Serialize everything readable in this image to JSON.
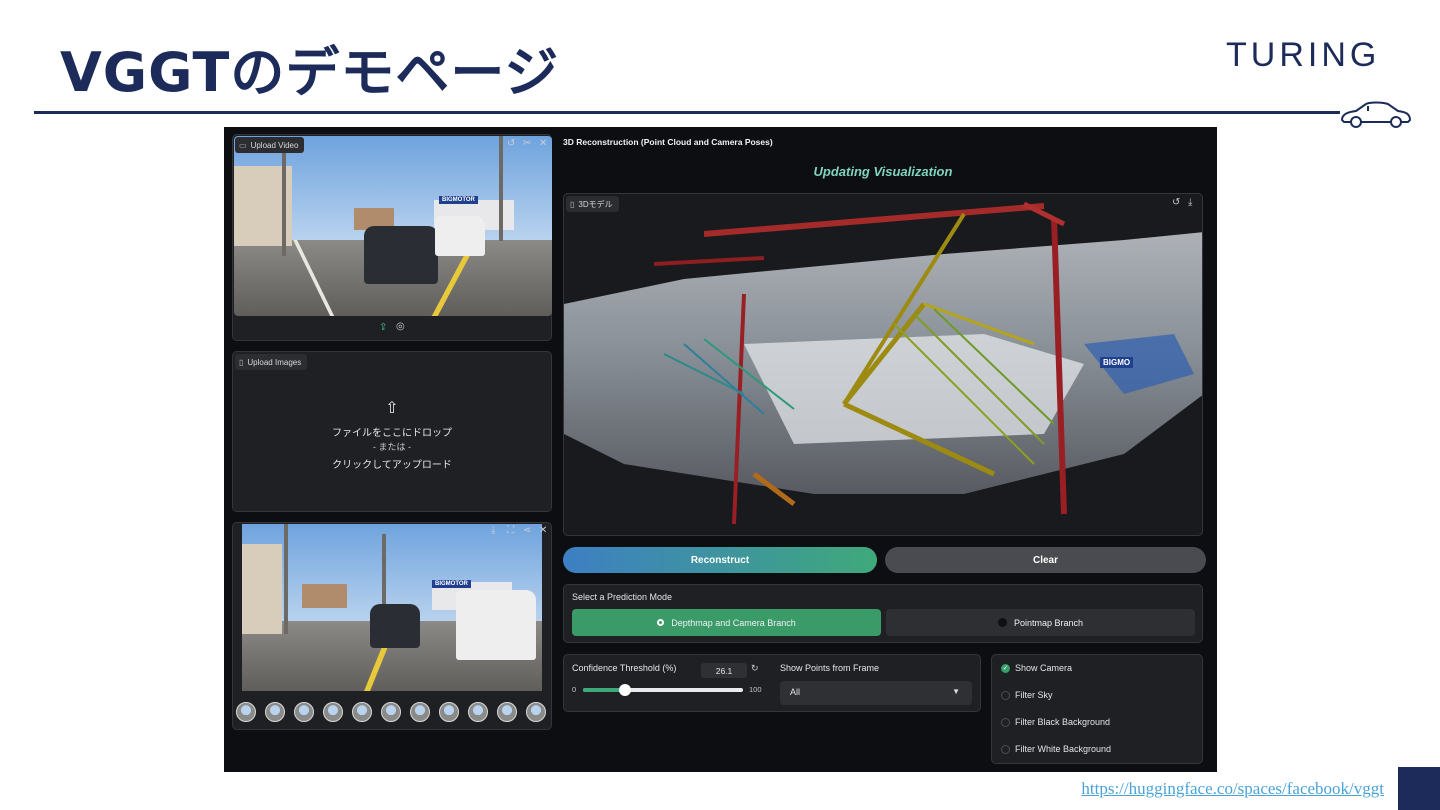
{
  "slide": {
    "title": "VGGTのデモページ",
    "brand": "TURING",
    "footer_link": "https://huggingface.co/spaces/facebook/vggt",
    "accent_color": "#1c2b5a",
    "car_icon": "car-outline-icon"
  },
  "app": {
    "video_panel": {
      "tag": "Upload Video",
      "tag_icon": "video-icon",
      "top_icons": [
        "undo-icon",
        "scissors-icon",
        "close-icon"
      ],
      "bottom_icons": [
        "upload-icon",
        "webcam-icon"
      ],
      "sign_text": "BIGMOTOR"
    },
    "images_panel": {
      "tag": "Upload Images",
      "tag_icon": "file-icon",
      "upload_icon": "upload-icon",
      "drop_text": "ファイルをここにドロップ",
      "or_text": "- または -",
      "click_text": "クリックしてアップロード"
    },
    "gallery_panel": {
      "top_icons": [
        "download-icon",
        "fullscreen-icon",
        "share-icon",
        "close-icon"
      ],
      "sign_text": "BIGMOTOR",
      "thumbnail_count": 11
    },
    "reconstruction": {
      "heading": "3D Reconstruction (Point Cloud and Camera Poses)",
      "status": "Updating Visualization",
      "model_tag": "3Dモデル",
      "model_icons": [
        "reset-icon",
        "download-icon"
      ],
      "scene_sign": "BIGMO"
    },
    "buttons": {
      "reconstruct": "Reconstruct",
      "clear": "Clear"
    },
    "prediction_mode": {
      "label": "Select a Prediction Mode",
      "options": [
        "Depthmap and Camera Branch",
        "Pointmap Branch"
      ],
      "selected": "Depthmap and Camera Branch"
    },
    "confidence": {
      "label": "Confidence Threshold (%)",
      "value": "26.1",
      "min": "0",
      "max": "100",
      "fraction": 0.261
    },
    "frame_filter": {
      "label": "Show Points from Frame",
      "selected": "All"
    },
    "checkboxes": [
      {
        "label": "Show Camera",
        "checked": true
      },
      {
        "label": "Filter Sky",
        "checked": false
      },
      {
        "label": "Filter Black Background",
        "checked": false
      },
      {
        "label": "Filter White Background",
        "checked": false
      }
    ],
    "colors": {
      "reconstruct_gradient": [
        "#3d7fc4",
        "#3fa97a"
      ],
      "selected_mode": "#3a9a68",
      "status_text": "#7fd3c0"
    }
  }
}
